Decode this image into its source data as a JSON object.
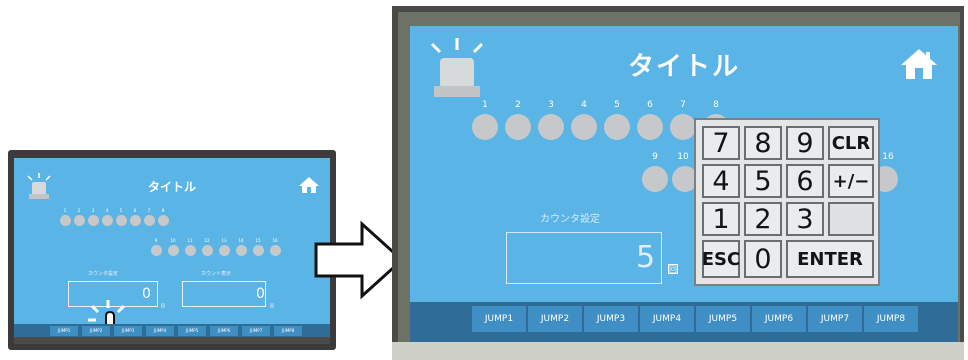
{
  "colors": {
    "screen": "#5bb4e6",
    "jumpbar": "#2f6c97",
    "jump_button": "#3f8fc4",
    "dot": "#c7c8c9",
    "bezel": "#3a3b3a"
  },
  "small_panel": {
    "title": "タイトル",
    "row1_numbers": [
      "1",
      "2",
      "3",
      "4",
      "5",
      "6",
      "7",
      "8"
    ],
    "row2_numbers": [
      "9",
      "10",
      "11",
      "12",
      "13",
      "14",
      "15",
      "16"
    ],
    "counter_setting_label": "カウンタ設定",
    "count_display_label": "カウント表示",
    "counter_setting_value": "0",
    "count_display_value": "0",
    "unit": "回",
    "jump_buttons": [
      "JUMP1",
      "JUMP2",
      "JUMP3",
      "JUMP4",
      "JUMP5",
      "JUMP6",
      "JUMP7",
      "JUMP8"
    ],
    "icons": [
      "siren-lamp-icon",
      "home-icon",
      "tap-hand-icon"
    ]
  },
  "arrow_icon": "right-arrow-icon",
  "big_panel": {
    "title": "タイトル",
    "row1_numbers": [
      "1",
      "2",
      "3",
      "4",
      "5",
      "6",
      "7",
      "8"
    ],
    "row2_numbers": [
      "9",
      "10",
      "16"
    ],
    "counter_setting_label": "カウンタ設定",
    "counter_setting_value": "5",
    "unit": "回",
    "jump_buttons": [
      "JUMP1",
      "JUMP2",
      "JUMP3",
      "JUMP4",
      "JUMP5",
      "JUMP6",
      "JUMP7",
      "JUMP8"
    ],
    "keypad": {
      "row1": [
        "7",
        "8",
        "9",
        "CLR"
      ],
      "row2": [
        "4",
        "5",
        "6",
        "+/−"
      ],
      "row3": [
        "1",
        "2",
        "3",
        ""
      ],
      "row4": [
        "ESC",
        "0",
        "ENTER"
      ]
    }
  }
}
